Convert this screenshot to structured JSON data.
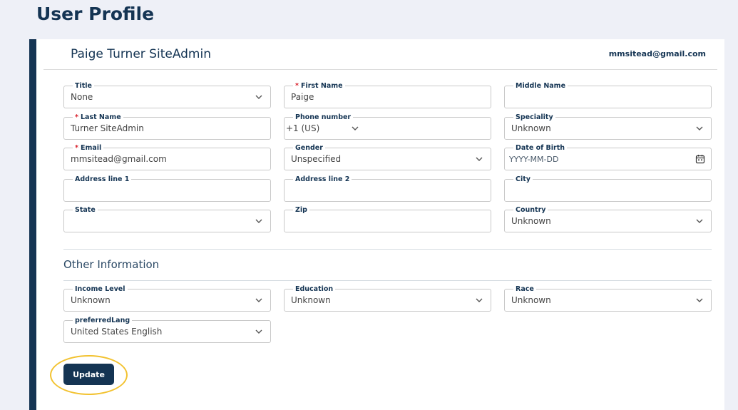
{
  "page": {
    "title": "User Profile"
  },
  "header": {
    "user_name": "Paige Turner SiteAdmin",
    "email": "mmsitead@gmail.com"
  },
  "fields": {
    "title": {
      "label": "Title",
      "value": "None",
      "required": false
    },
    "first_name": {
      "label": "First Name",
      "value": "Paige",
      "required": true
    },
    "middle_name": {
      "label": "Middle Name",
      "value": "",
      "required": false
    },
    "last_name": {
      "label": "Last Name",
      "value": "Turner SiteAdmin",
      "required": true
    },
    "phone": {
      "label": "Phone number",
      "value": "+1 (US)",
      "required": false
    },
    "speciality": {
      "label": "Speciality",
      "value": "Unknown",
      "required": false
    },
    "email": {
      "label": "Email",
      "value": "mmsitead@gmail.com",
      "required": true
    },
    "gender": {
      "label": "Gender",
      "value": "Unspecified",
      "required": false
    },
    "dob": {
      "label": "Date of Birth",
      "placeholder": "YYYY-MM-DD",
      "required": false
    },
    "address1": {
      "label": "Address line 1",
      "value": ""
    },
    "address2": {
      "label": "Address line 2",
      "value": ""
    },
    "city": {
      "label": "City",
      "value": ""
    },
    "state": {
      "label": "State",
      "value": ""
    },
    "zip": {
      "label": "Zip",
      "value": ""
    },
    "country": {
      "label": "Country",
      "value": "Unknown"
    }
  },
  "other": {
    "title": "Other Information",
    "income": {
      "label": "Income Level",
      "value": "Unknown"
    },
    "education": {
      "label": "Education",
      "value": "Unknown"
    },
    "race": {
      "label": "Race",
      "value": "Unknown"
    },
    "lang": {
      "label": "preferredLang",
      "value": "United States English"
    }
  },
  "actions": {
    "update_label": "Update"
  },
  "icons": {
    "dropdown": "chevron-down-icon",
    "calendar": "calendar-icon"
  },
  "colors": {
    "brand": "#143453",
    "required": "#d9212c",
    "highlight": "#f2c230"
  }
}
